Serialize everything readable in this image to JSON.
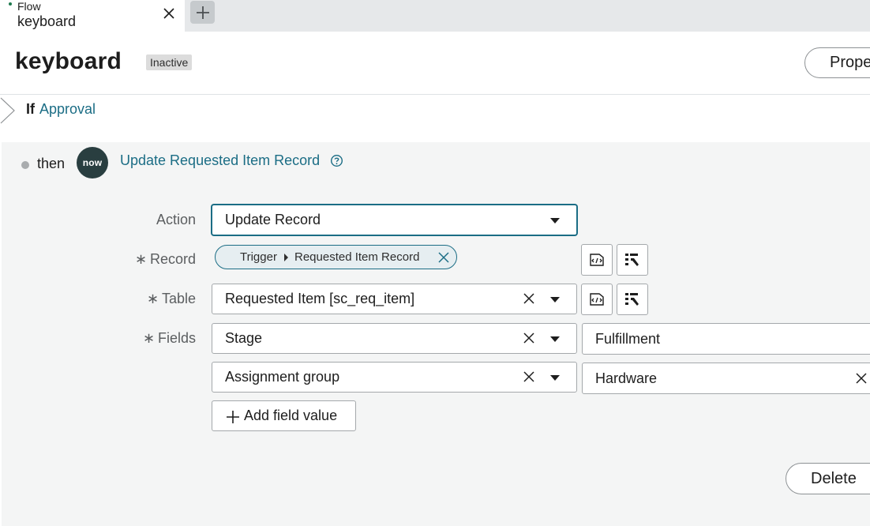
{
  "tab": {
    "type_label": "Flow",
    "name": "keyboard"
  },
  "header": {
    "title": "keyboard",
    "status": "Inactive",
    "properties_label": "Properties"
  },
  "condition": {
    "keyword": "If",
    "link": "Approval"
  },
  "action": {
    "then_label": "then",
    "logo_text": "now",
    "title": "Update Requested Item Record",
    "form": {
      "action_label": "Action",
      "action_value": "Update Record",
      "record_label": "Record",
      "record_pill_source": "Trigger",
      "record_pill_value": "Requested Item Record",
      "table_label": "Table",
      "table_value": "Requested Item [sc_req_item]",
      "fields_label": "Fields",
      "fields": [
        {
          "field": "Stage",
          "value": "Fulfillment"
        },
        {
          "field": "Assignment group",
          "value": "Hardware"
        }
      ],
      "add_field_label": "Add field value",
      "required_mark": "∗"
    },
    "delete_label": "Delete"
  },
  "colors": {
    "accent": "#1b6d85",
    "logo_bg": "#293e40",
    "panel_bg": "#f4f5f5"
  },
  "icons": [
    "close-icon",
    "plus-icon",
    "chevron-right-icon",
    "help-icon",
    "caret-down-icon",
    "script-icon",
    "data-pill-picker-icon"
  ]
}
